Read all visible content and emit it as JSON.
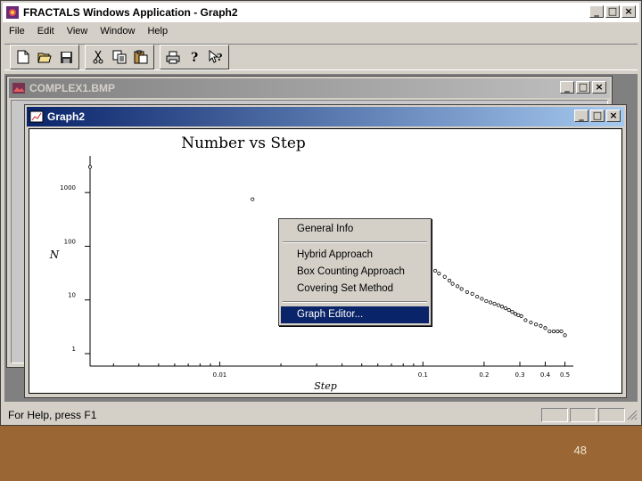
{
  "app": {
    "title": "FRACTALS Windows Application - Graph2",
    "menu": [
      "File",
      "Edit",
      "View",
      "Window",
      "Help"
    ],
    "toolbar_icons": [
      "new-icon",
      "open-icon",
      "save-icon",
      "cut-icon",
      "copy-icon",
      "paste-icon",
      "print-icon",
      "help-icon",
      "context-help-icon"
    ],
    "caption_buttons": [
      "_",
      "□",
      "×"
    ]
  },
  "complex_window": {
    "title": "COMPLEX1.BMP"
  },
  "graph_window": {
    "title": "Graph2"
  },
  "chart_data": {
    "type": "scatter",
    "title": "Number vs Step",
    "xlabel": "Step",
    "ylabel": "N",
    "xscale": "log",
    "yscale": "log",
    "x_ticks": [
      "0.01",
      "0.1",
      "0.2",
      "0.3",
      "0.4",
      "0.5"
    ],
    "y_ticks": [
      "1",
      "10",
      "100",
      "1000"
    ],
    "points": [
      {
        "x": 0.0023,
        "y": 3000
      },
      {
        "x": 0.0145,
        "y": 750
      },
      {
        "x": 0.108,
        "y": 39
      },
      {
        "x": 0.115,
        "y": 35
      },
      {
        "x": 0.12,
        "y": 31
      },
      {
        "x": 0.128,
        "y": 27
      },
      {
        "x": 0.135,
        "y": 23
      },
      {
        "x": 0.14,
        "y": 20
      },
      {
        "x": 0.148,
        "y": 18
      },
      {
        "x": 0.155,
        "y": 16
      },
      {
        "x": 0.165,
        "y": 14
      },
      {
        "x": 0.175,
        "y": 13
      },
      {
        "x": 0.185,
        "y": 11.5
      },
      {
        "x": 0.195,
        "y": 10.5
      },
      {
        "x": 0.205,
        "y": 9.5
      },
      {
        "x": 0.215,
        "y": 9
      },
      {
        "x": 0.225,
        "y": 8.5
      },
      {
        "x": 0.235,
        "y": 8
      },
      {
        "x": 0.245,
        "y": 7.5
      },
      {
        "x": 0.255,
        "y": 7
      },
      {
        "x": 0.265,
        "y": 6.5
      },
      {
        "x": 0.275,
        "y": 6
      },
      {
        "x": 0.285,
        "y": 5.5
      },
      {
        "x": 0.295,
        "y": 5.2
      },
      {
        "x": 0.305,
        "y": 5
      },
      {
        "x": 0.32,
        "y": 4.2
      },
      {
        "x": 0.34,
        "y": 3.8
      },
      {
        "x": 0.36,
        "y": 3.5
      },
      {
        "x": 0.38,
        "y": 3.3
      },
      {
        "x": 0.4,
        "y": 3.0
      },
      {
        "x": 0.42,
        "y": 2.6
      },
      {
        "x": 0.44,
        "y": 2.6
      },
      {
        "x": 0.46,
        "y": 2.6
      },
      {
        "x": 0.48,
        "y": 2.6
      },
      {
        "x": 0.5,
        "y": 2.2
      }
    ]
  },
  "context_menu": {
    "items": [
      "General Info",
      "Hybrid Approach",
      "Box Counting Approach",
      "Covering Set Method",
      "Graph Editor..."
    ],
    "selected": "Graph Editor..."
  },
  "status": {
    "text": "For Help, press F1"
  },
  "slide": {
    "number": "48"
  }
}
